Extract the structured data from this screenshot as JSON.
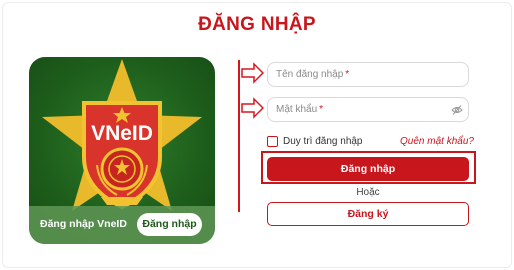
{
  "page": {
    "title": "ĐĂNG NHẬP"
  },
  "vneid_card": {
    "logo_text": "VNeID",
    "label": "Đăng nhập VneID",
    "button_label": "Đăng nhập",
    "colors": {
      "green": "#1f5a1c",
      "gold": "#f2c230",
      "red": "#d32f2f"
    }
  },
  "form": {
    "username_placeholder": "Tên đăng nhập",
    "password_placeholder": "Mật khẩu",
    "required_mark": "*",
    "remember_label": "Duy trì đăng nhập",
    "forgot_label": "Quên mật khẩu?",
    "login_button": "Đăng nhập",
    "or_label": "Hoặc",
    "register_button": "Đăng ký",
    "password_toggle_icon": "eye-off-icon"
  },
  "theme": {
    "accent": "#c8161d",
    "annotation": "#d6161d"
  }
}
